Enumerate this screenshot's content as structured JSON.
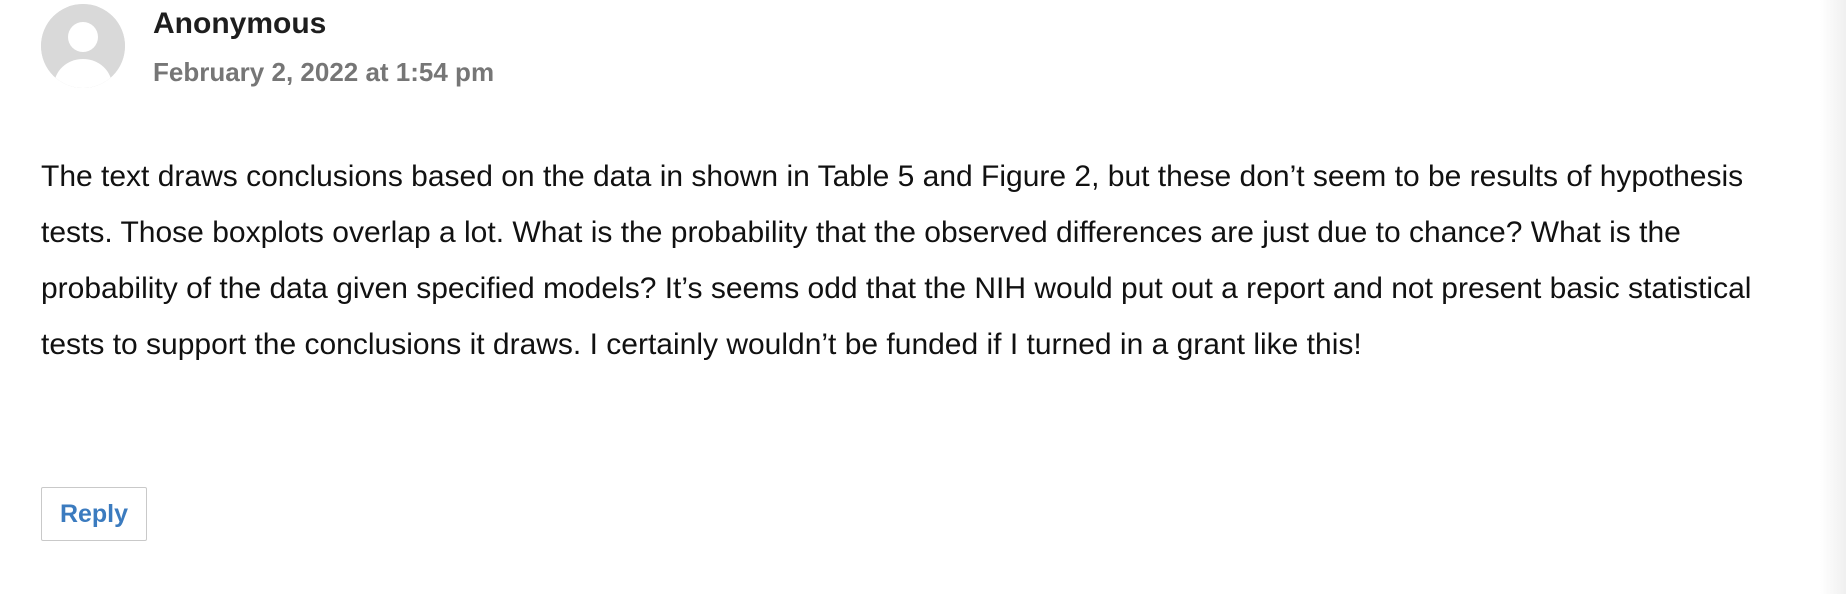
{
  "comment": {
    "avatar_icon": "user-silhouette-icon",
    "author": "Anonymous",
    "date": "February 2, 2022 at 1:54 pm",
    "body": "The text draws conclusions based on the data in shown in Table 5 and Figure 2, but these don’t seem to be results of hypothesis tests. Those boxplots overlap a lot. What is the probability that the observed differences are just due to chance? What is the probability of the data given specified models? It’s seems odd that the NIH would put out a report and not present basic statistical tests to support the conclusions it draws. I certainly wouldn’t be funded if I turned in a grant like this!",
    "reply_label": "Reply"
  },
  "colors": {
    "author": "#1e1e1e",
    "date": "#767676",
    "reply_link": "#3b7bbf",
    "avatar_bg": "#d9d9d9"
  }
}
